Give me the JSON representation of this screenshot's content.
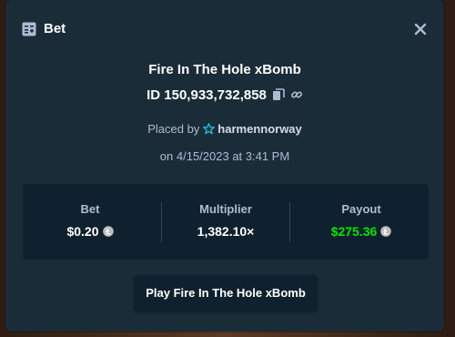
{
  "header": {
    "title": "Bet",
    "icon": "bet-slip-icon",
    "close_icon": "close-icon"
  },
  "bet": {
    "game_title": "Fire In The Hole xBomb",
    "id_label": "ID 150,933,732,858",
    "copy_icon": "copy-icon",
    "link_icon": "link-icon",
    "placed_by_prefix": "Placed by",
    "user_icon": "star-badge-icon",
    "username": "harmennorway",
    "date_text": "on 4/15/2023 at 3:41 PM"
  },
  "stats": {
    "bet_label": "Bet",
    "bet_value": "$0.20",
    "multiplier_label": "Multiplier",
    "multiplier_value": "1,382.10×",
    "payout_label": "Payout",
    "payout_value": "$275.36",
    "currency_icon": "litecoin-icon"
  },
  "actions": {
    "play_label": "Play Fire In The Hole xBomb"
  },
  "colors": {
    "modal_bg": "#1a2c38",
    "panel_bg": "#0f212e",
    "text_muted": "#b1bad3",
    "text_white": "#ffffff",
    "payout_green": "#00e701",
    "accent_teal": "#1fb8e0"
  }
}
